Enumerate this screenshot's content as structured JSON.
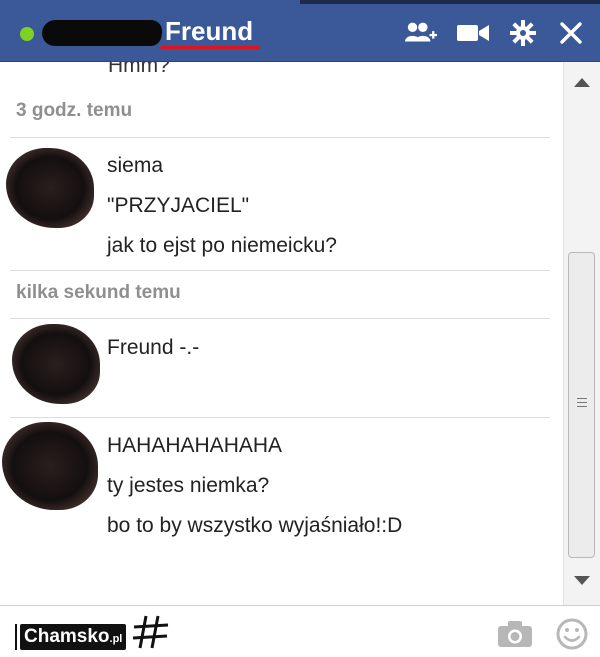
{
  "header": {
    "contact_name": "Freund",
    "icons": [
      "add-friend-icon",
      "video-call-icon",
      "settings-gear-icon",
      "close-icon"
    ],
    "status_color": "#7ed321",
    "bar_color": "#3b5998"
  },
  "conversation": {
    "partial_top_message": "Hmm?",
    "groups": [
      {
        "timestamp": "3 godz. temu",
        "messages": [
          {
            "lines": [
              "siema",
              "\"PRZYJACIEL\"",
              "jak to ejst po niemeicku?"
            ]
          }
        ]
      },
      {
        "timestamp": "kilka sekund temu",
        "messages": [
          {
            "lines": [
              "Freund -.-"
            ]
          },
          {
            "lines": [
              "HAHAHAHAHAHA",
              "ty jestes niemka?",
              "bo to by wszystko wyjaśniało!:D"
            ]
          }
        ]
      }
    ]
  },
  "input": {
    "watermark_text": "Chamsko",
    "watermark_suffix": ".pl",
    "icons": [
      "camera-icon",
      "emoji-icon"
    ]
  }
}
